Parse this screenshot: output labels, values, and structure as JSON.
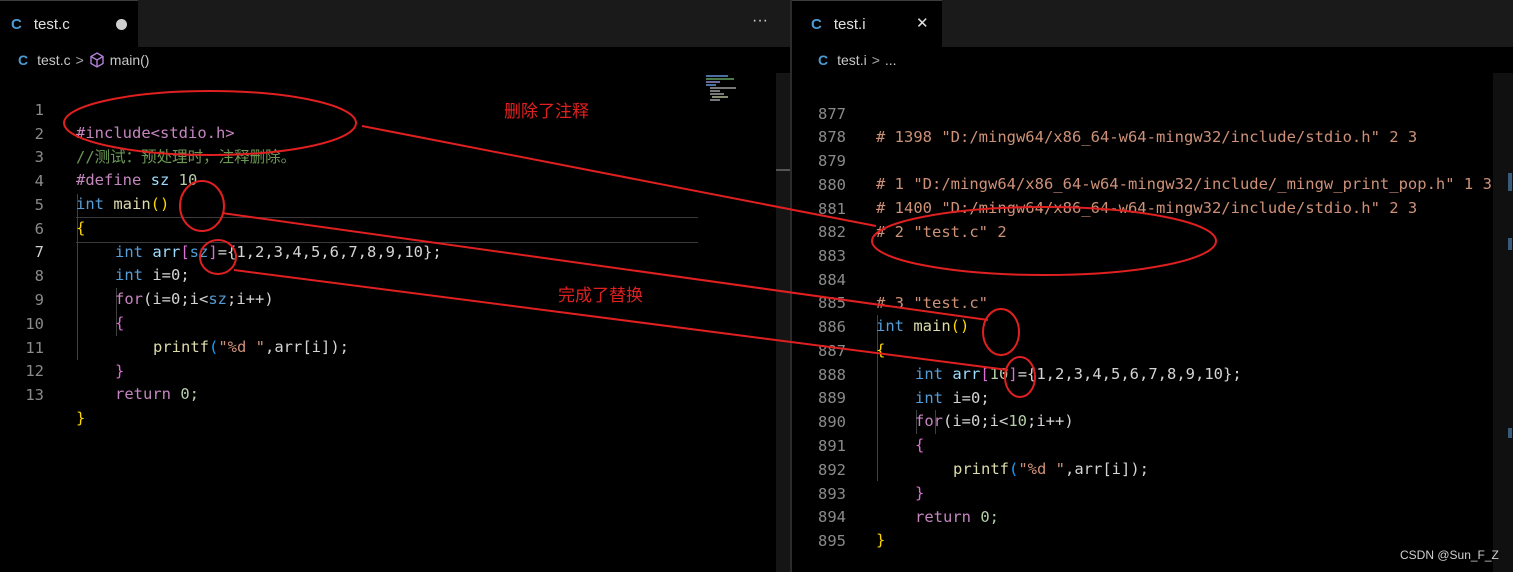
{
  "left_pane": {
    "tab": {
      "icon": "C",
      "title": "test.c",
      "more": "···"
    },
    "breadcrumb": {
      "file": "test.c",
      "sep": ">",
      "symbol": "main()"
    },
    "lines": [
      {
        "num": "1"
      },
      {
        "num": "2"
      },
      {
        "num": "3"
      },
      {
        "num": "4"
      },
      {
        "num": "5"
      },
      {
        "num": "6"
      },
      {
        "num": "7"
      },
      {
        "num": "8"
      },
      {
        "num": "9"
      },
      {
        "num": "10"
      },
      {
        "num": "11"
      },
      {
        "num": "12"
      },
      {
        "num": "13"
      }
    ],
    "code": {
      "l1": "#include<stdio.h>",
      "l2": "//测试：预处理时，注释删除。",
      "l3_a": "#define",
      "l3_b": " sz ",
      "l3_c": "10",
      "l4_a": "int",
      "l4_b": " main",
      "l4_c": "()",
      "l5": "{",
      "l6_a": "int",
      "l6_b": " arr",
      "l6_c": "[",
      "l6_d": "sz",
      "l6_e": "]",
      "l6_f": "={1,2,3,4,5,6,7,8,9,10};",
      "l7_a": "int",
      "l7_b": " i=0;",
      "l8_a": "for",
      "l8_b": "(i=0;i<",
      "l8_c": "sz",
      "l8_d": ";i++)",
      "l9": "{",
      "l10_a": "printf",
      "l10_b": "(",
      "l10_c": "\"%d \"",
      "l10_d": ",arr[i]);",
      "l11": "}",
      "l12_a": "return",
      "l12_b": " 0;",
      "l13": "}"
    }
  },
  "right_pane": {
    "tab": {
      "icon": "C",
      "title": "test.i",
      "close": "✕"
    },
    "breadcrumb": {
      "file": "test.i",
      "sep": ">",
      "more": "..."
    },
    "lines": [
      {
        "num": "877"
      },
      {
        "num": "878"
      },
      {
        "num": "879"
      },
      {
        "num": "880"
      },
      {
        "num": "881"
      },
      {
        "num": "882"
      },
      {
        "num": "883"
      },
      {
        "num": "884"
      },
      {
        "num": "885"
      },
      {
        "num": "886"
      },
      {
        "num": "887"
      },
      {
        "num": "888"
      },
      {
        "num": "889"
      },
      {
        "num": "890"
      },
      {
        "num": "891"
      },
      {
        "num": "892"
      },
      {
        "num": "893"
      },
      {
        "num": "894"
      },
      {
        "num": "895"
      }
    ],
    "code": {
      "r877": "# 1398 \"D:/mingw64/x86_64-w64-mingw32/include/stdio.h\" 2 3",
      "r879": "# 1 \"D:/mingw64/x86_64-w64-mingw32/include/_mingw_print_pop.h\" 1 3",
      "r880": "# 1400 \"D:/mingw64/x86_64-w64-mingw32/include/stdio.h\" 2 3",
      "r881": "# 2 \"test.c\" 2",
      "r884": "# 3 \"test.c\"",
      "r885_a": "int",
      "r885_b": " main",
      "r885_c": "()",
      "r886": "{",
      "r887_a": "int",
      "r887_b": " arr",
      "r887_c": "[",
      "r887_d": "10",
      "r887_e": "]",
      "r887_f": "={1,2,3,4,5,6,7,8,9,10};",
      "r888_a": "int",
      "r888_b": " i=0;",
      "r889_a": "for",
      "r889_b": "(i=0;i<",
      "r889_c": "10",
      "r889_d": ";i++)",
      "r890": "{",
      "r891_a": "printf",
      "r891_b": "(",
      "r891_c": "\"%d \"",
      "r891_d": ",arr[i]);",
      "r892": "}",
      "r893_a": "return",
      "r893_b": " 0;",
      "r894": "}"
    }
  },
  "annotations": {
    "comment_removed": "删除了注释",
    "replaced": "完成了替换"
  },
  "watermark": "CSDN @Sun_F_Z",
  "colors": {
    "annotation_red": "#e02020",
    "keyword_blue": "#569cd6",
    "comment_green": "#6a9955"
  }
}
